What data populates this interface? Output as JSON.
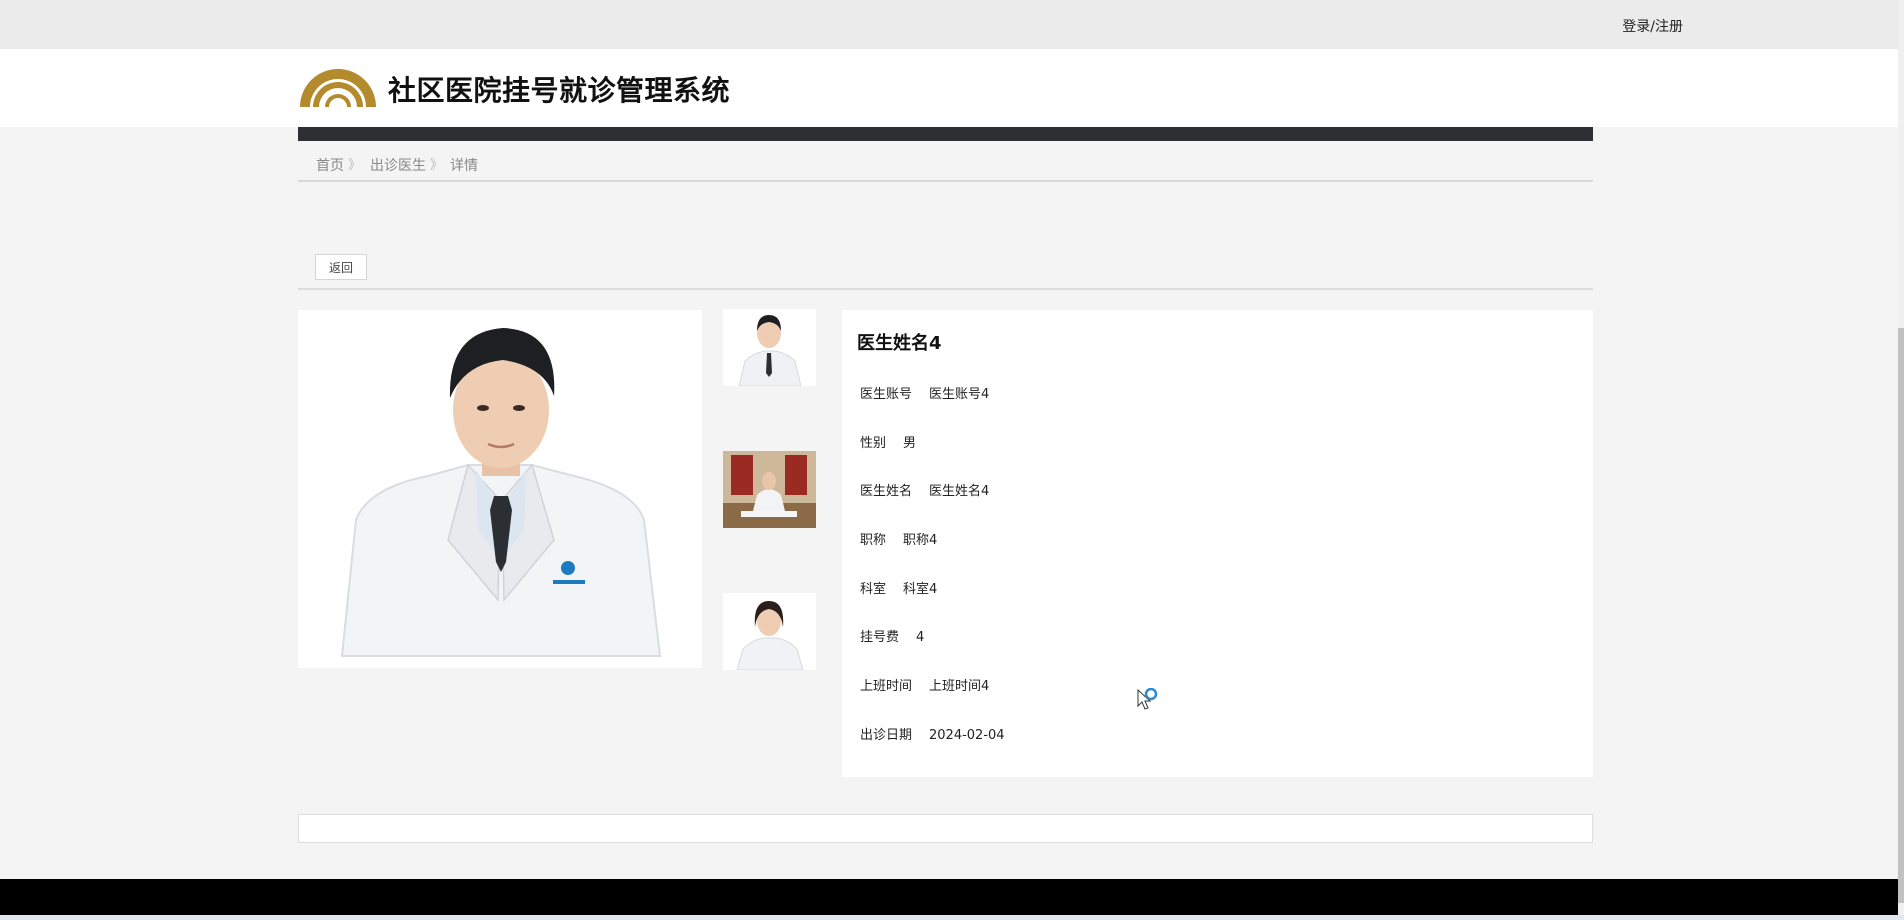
{
  "topbar": {
    "login_label": "登录/注册"
  },
  "header": {
    "title": "社区医院挂号就诊管理系统",
    "logo_color": "#b38a2c"
  },
  "breadcrumb": {
    "items": [
      "首页",
      "出诊医生",
      "详情"
    ],
    "separator": "》"
  },
  "toolbar": {
    "back_label": "返回"
  },
  "doctor": {
    "name": "医生姓名4",
    "fields": [
      {
        "label": "医生账号",
        "value": "医生账号4"
      },
      {
        "label": "性别",
        "value": "男"
      },
      {
        "label": "医生姓名",
        "value": "医生姓名4"
      },
      {
        "label": "职称",
        "value": "职称4"
      },
      {
        "label": "科室",
        "value": "科室4"
      },
      {
        "label": "挂号费",
        "value": "4"
      },
      {
        "label": "上班时间",
        "value": "上班时间4"
      },
      {
        "label": "出诊日期",
        "value": "2024-02-04"
      }
    ]
  },
  "colors": {
    "navbar": "#2d3033",
    "background": "#f4f4f4",
    "footer": "#000000"
  }
}
